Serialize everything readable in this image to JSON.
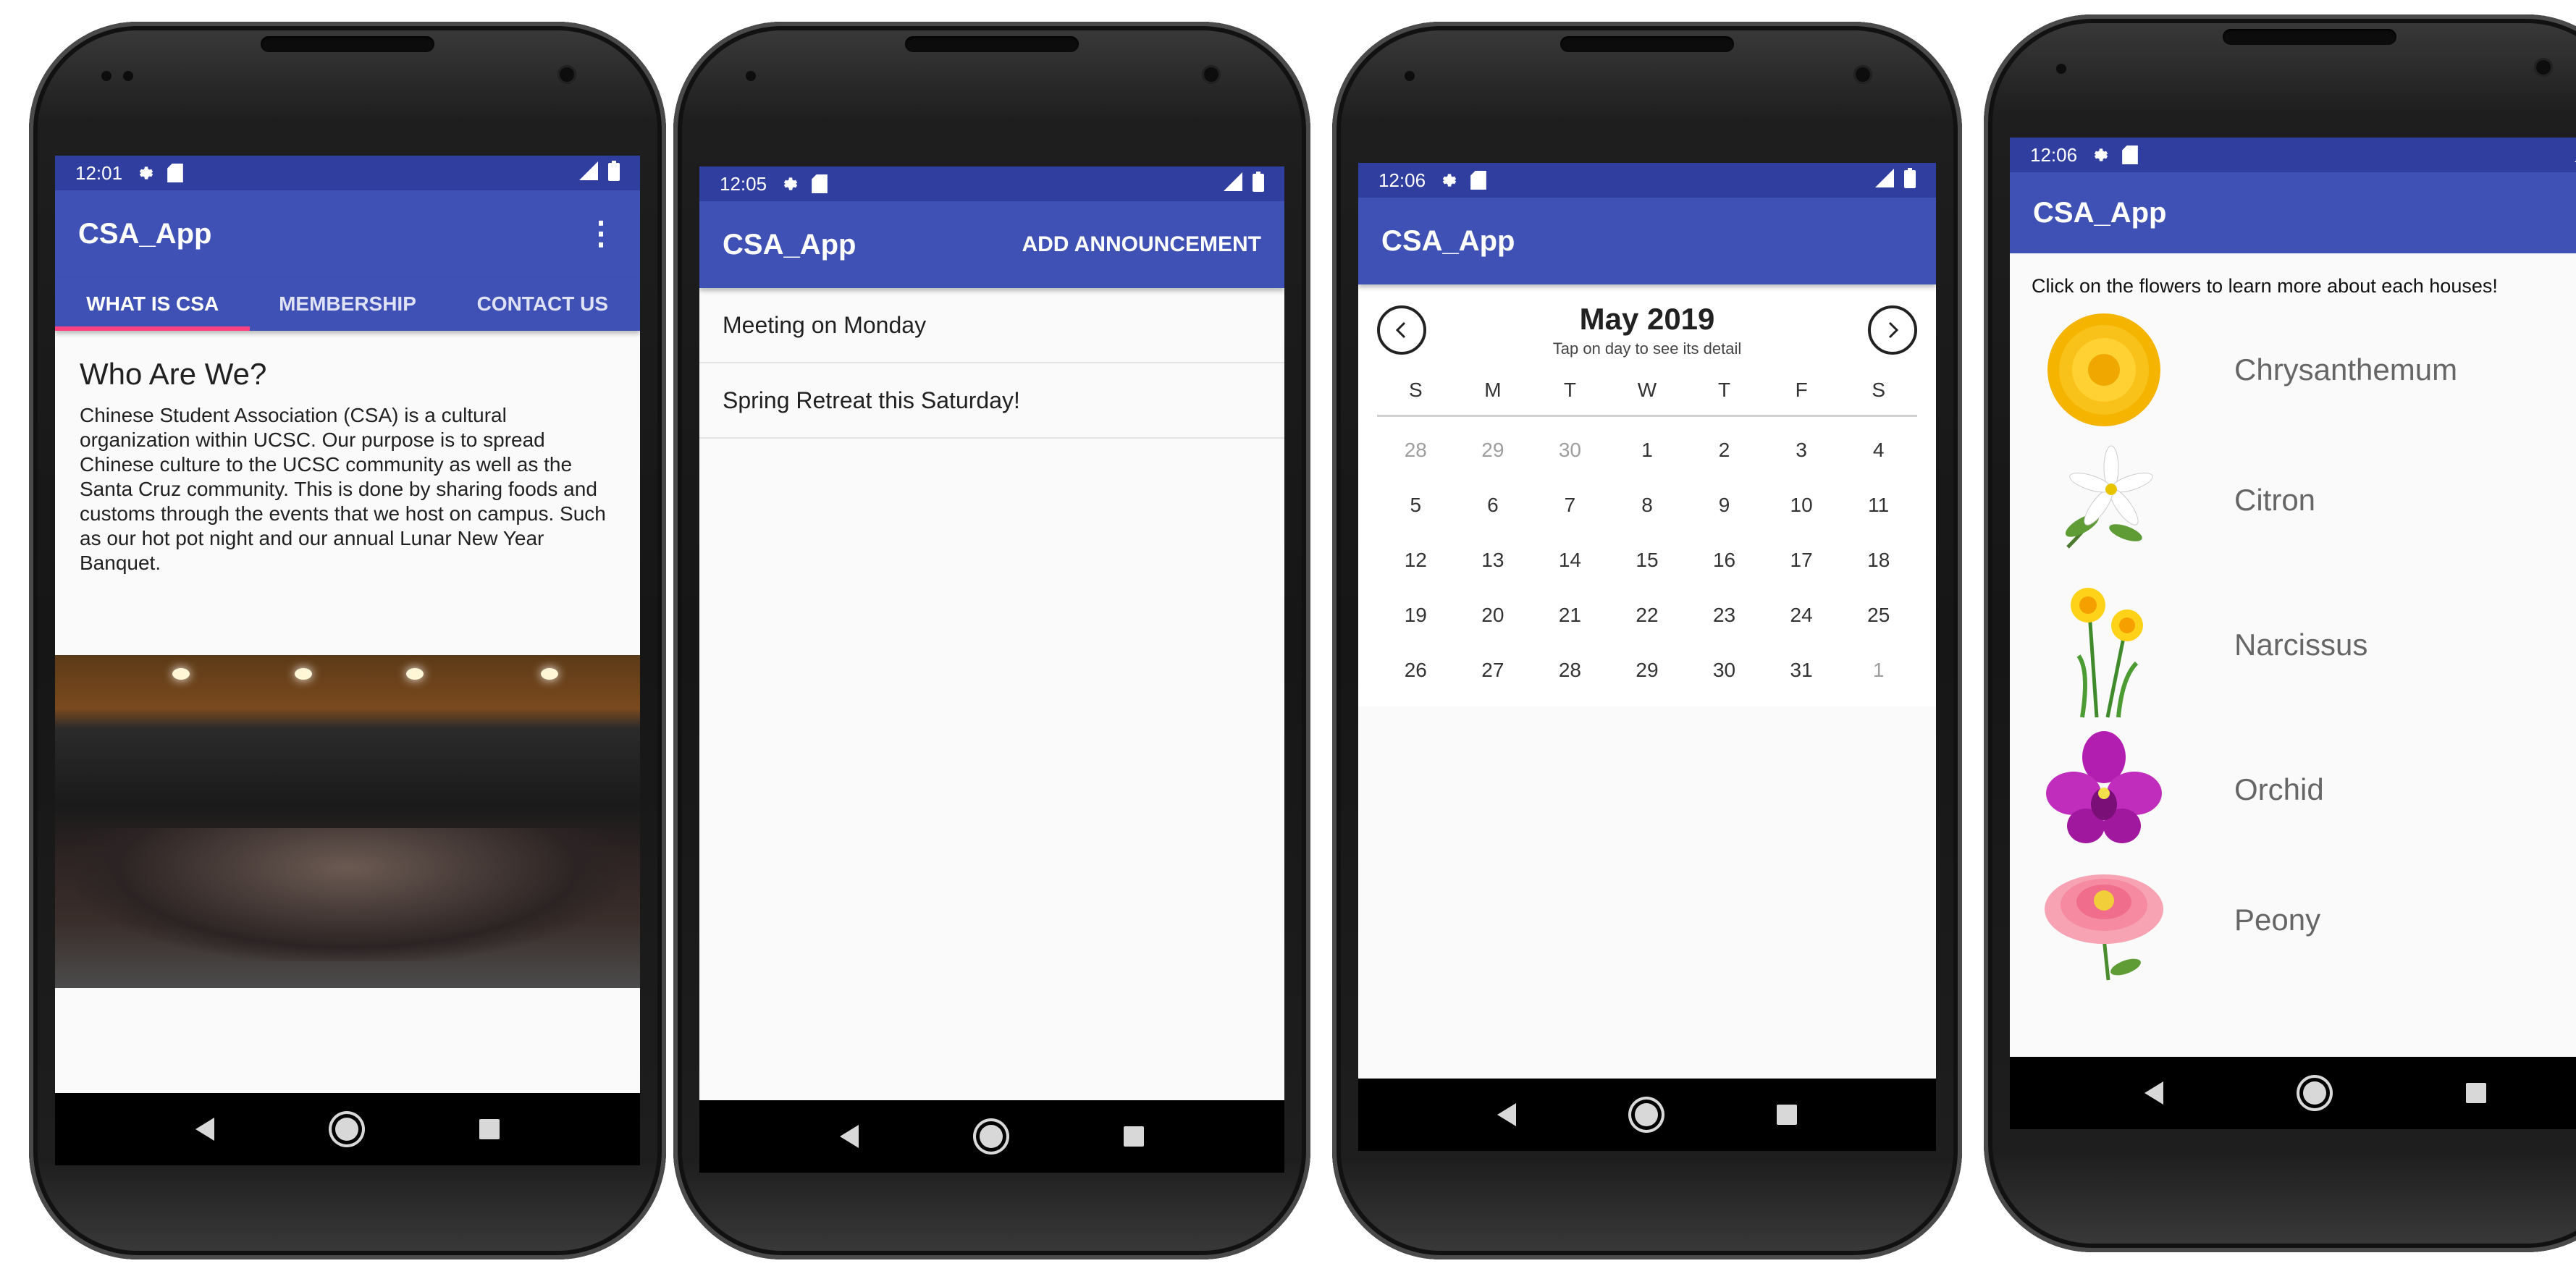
{
  "screens": [
    {
      "status_time": "12:01",
      "app_title": "CSA_App",
      "tabs": [
        "WHAT IS CSA",
        "MEMBERSHIP",
        "CONTACT US"
      ],
      "heading": "Who Are We?",
      "body": "Chinese Student Association (CSA) is a cultural organization within UCSC. Our purpose is to spread Chinese culture to the UCSC community as well as the Santa Cruz community. This is done by sharing foods and customs through the events that we host on campus. Such as our hot pot night and our annual Lunar New Year Banquet."
    },
    {
      "status_time": "12:05",
      "app_title": "CSA_App",
      "action": "ADD ANNOUNCEMENT",
      "announcements": [
        "Meeting on Monday",
        "Spring Retreat this Saturday!"
      ]
    },
    {
      "status_time": "12:06",
      "app_title": "CSA_App",
      "month": "May 2019",
      "hint": "Tap on day to see its detail",
      "weekdays": [
        "S",
        "M",
        "T",
        "W",
        "T",
        "F",
        "S"
      ],
      "days": [
        "28",
        "29",
        "30",
        "1",
        "2",
        "3",
        "4",
        "5",
        "6",
        "7",
        "8",
        "9",
        "10",
        "11",
        "12",
        "13",
        "14",
        "15",
        "16",
        "17",
        "18",
        "19",
        "20",
        "21",
        "22",
        "23",
        "24",
        "25",
        "26",
        "27",
        "28",
        "29",
        "30",
        "31",
        "1"
      ]
    },
    {
      "status_time": "12:06",
      "app_title": "CSA_App",
      "instruction": "Click on the flowers to learn more about each houses!",
      "flowers": [
        "Chrysanthemum",
        "Citron",
        "Narcissus",
        "Orchid",
        "Peony"
      ]
    }
  ],
  "colors": {
    "status_bar": "#303f9f",
    "app_bar": "#3f51b5",
    "tab_indicator": "#ff4081"
  }
}
